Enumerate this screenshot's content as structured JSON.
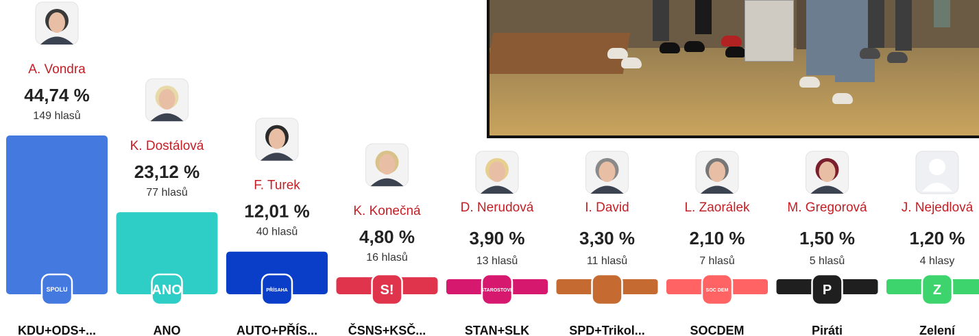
{
  "chart_data": {
    "type": "bar",
    "categories": [
      "KDU+ODS+...",
      "ANO",
      "AUTO+PŘÍS...",
      "ČSNS+KSČ...",
      "STAN+SLK",
      "SPD+Trikol...",
      "SOCDEM",
      "Piráti",
      "Zelení"
    ],
    "values": [
      44.74,
      23.12,
      12.01,
      4.8,
      3.9,
      3.3,
      2.1,
      1.5,
      1.2
    ],
    "value_labels": [
      "44,74 %",
      "23,12 %",
      "12,01 %",
      "4,80 %",
      "3,90 %",
      "3,30 %",
      "2,10 %",
      "1,50 %",
      "1,20 %"
    ],
    "votes": [
      "149 hlasů",
      "77 hlasů",
      "40 hlasů",
      "16 hlasů",
      "13 hlasů",
      "11 hlasů",
      "7 hlasů",
      "5 hlasů",
      "4 hlasy"
    ],
    "candidates": [
      "A. Vondra",
      "K. Dostálová",
      "F. Turek",
      "K. Konečná",
      "D. Nerudová",
      "I. David",
      "L. Zaorálek",
      "M. Gregorová",
      "J. Nejedlová"
    ],
    "colors": [
      "#4479e0",
      "#2ecdc6",
      "#0b3ec8",
      "#e0344c",
      "#d6196e",
      "#c56b31",
      "#ff6363",
      "#1f1f1f",
      "#3ed46d"
    ],
    "logos": [
      "SPOLU",
      "ANO",
      "PŘÍSAHA",
      "S!",
      "STAROSTOVÉ",
      "",
      "SOC DEM",
      "P",
      "Z"
    ],
    "accent_name_color": "#c41e24",
    "ylim": [
      0,
      44.74
    ]
  }
}
